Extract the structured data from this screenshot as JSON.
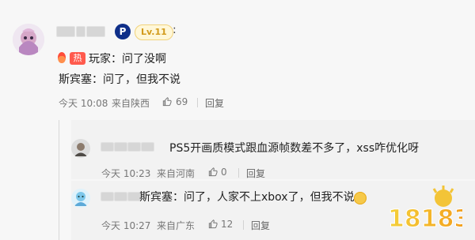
{
  "comment": {
    "level_badge": "Lv.11",
    "separator": ":",
    "hot_label": "热",
    "line1": "玩家：问了没啊",
    "line2": "斯宾塞：问了，但我不说",
    "time": "今天 10:08",
    "location": "来自陕西",
    "likes": "69",
    "reply_label": "回复",
    "icons": {
      "avatar": "avatar-image",
      "platform": "playstation-icon",
      "hot": "fire-icon",
      "like": "thumb-up-icon"
    }
  },
  "replies": [
    {
      "text": "PS5开画质模式跟血源帧数差不多了，xss咋优化呀",
      "time": "今天 10:23",
      "location": "来自河南",
      "likes": "0",
      "reply_label": "回复"
    },
    {
      "text": "斯宾塞：问了，人家不上xbox了，但我不说",
      "time": "今天 10:27",
      "location": "来自广东",
      "likes": "12",
      "reply_label": "回复"
    }
  ],
  "watermark_text": "18183",
  "colors": {
    "hot": "#ff5a4d",
    "level_bg": "#fff7d8",
    "level_text": "#d29a1b",
    "muted": "#777777",
    "background": "#f7f7f7"
  }
}
